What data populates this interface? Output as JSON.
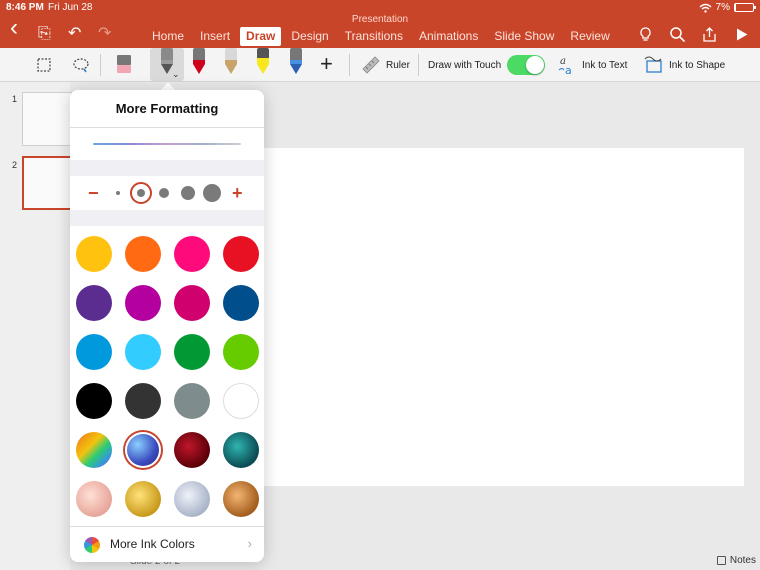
{
  "status": {
    "time": "8:46 PM",
    "day": "Fri Jun 28",
    "battery": "7%",
    "battery_level": 0.07,
    "wifi_icon": "wifi-icon",
    "battery_icon": "battery-icon"
  },
  "app": {
    "title": "Presentation",
    "accent": "#c8452a"
  },
  "appbar": {
    "back_icon": "‹",
    "file_icon": "⎘",
    "undo_icon": "↶",
    "redo_icon": "↷",
    "tabs": [
      {
        "label": "Home",
        "active": false
      },
      {
        "label": "Insert",
        "active": false
      },
      {
        "label": "Draw",
        "active": true
      },
      {
        "label": "Design",
        "active": false
      },
      {
        "label": "Transitions",
        "active": false
      },
      {
        "label": "Animations",
        "active": false
      },
      {
        "label": "Slide Show",
        "active": false
      },
      {
        "label": "Review",
        "active": false
      }
    ],
    "right_icons": {
      "lightbulb": "💡",
      "search": "⌕",
      "share": "⇪",
      "play": "▶"
    }
  },
  "ribbon": {
    "ruler_label": "Ruler",
    "draw_with_touch_label": "Draw with Touch",
    "draw_with_touch_on": true,
    "ink_to_text_label": "Ink to Text",
    "ink_to_shape_label": "Ink to Shape",
    "add_icon": "+",
    "pens": [
      {
        "name": "pen-gray",
        "band": "#9a9a9a"
      },
      {
        "name": "pen-red",
        "band": "#d0021b"
      },
      {
        "name": "pencil",
        "band": "#c8a46a"
      },
      {
        "name": "highlighter-yellow",
        "band": "#f8e71c"
      },
      {
        "name": "pen-galaxy",
        "band": "#4a90e2"
      }
    ]
  },
  "slides": {
    "items": [
      {
        "number": "1"
      },
      {
        "number": "2"
      }
    ],
    "footer": "Slide 2 of 2",
    "notes_label": "Notes"
  },
  "popover": {
    "title": "More Formatting",
    "minus": "−",
    "plus": "+",
    "more_ink_colors": "More Ink Colors",
    "chevron": "›",
    "colors": [
      {
        "name": "yellow",
        "fill": "#ffc20e"
      },
      {
        "name": "orange",
        "fill": "#ff6a13"
      },
      {
        "name": "pink",
        "fill": "#ff0a7a"
      },
      {
        "name": "red",
        "fill": "#e81123"
      },
      {
        "name": "purple",
        "fill": "#5c2d91"
      },
      {
        "name": "magenta",
        "fill": "#b4009e"
      },
      {
        "name": "crimson",
        "fill": "#d0006f"
      },
      {
        "name": "dark-blue",
        "fill": "#004e8c"
      },
      {
        "name": "blue",
        "fill": "#0099dd"
      },
      {
        "name": "sky-blue",
        "fill": "#33ccff"
      },
      {
        "name": "green",
        "fill": "#009933"
      },
      {
        "name": "lime",
        "fill": "#66cc00"
      },
      {
        "name": "black",
        "fill": "#000000"
      },
      {
        "name": "dark-gray",
        "fill": "#333333"
      },
      {
        "name": "gray",
        "fill": "#7f8c8d"
      },
      {
        "name": "white",
        "fill": "#ffffff"
      },
      {
        "name": "rainbow",
        "fill": "linear-gradient(135deg,#e74c3c,#f39c12,#f1c40f,#2ecc71,#3498db,#9b59b6)"
      },
      {
        "name": "galaxy",
        "fill": "radial-gradient(circle at 35% 35%,#8ad0ff,#3b4cc0 55%,#2b1d6e)",
        "selected": true
      },
      {
        "name": "ruby",
        "fill": "radial-gradient(circle at 40% 40%,#c0162a,#5a0008 70%)"
      },
      {
        "name": "ocean",
        "fill": "radial-gradient(circle at 40% 40%,#2fb4b0,#0b4a52 70%)"
      },
      {
        "name": "rose-gold",
        "fill": "radial-gradient(circle at 40% 40%,#ffe0d6,#e7a59a 70%)"
      },
      {
        "name": "gold",
        "fill": "radial-gradient(circle at 40% 40%,#ffe27a,#c89a1b 70%)"
      },
      {
        "name": "silver",
        "fill": "radial-gradient(circle at 40% 40%,#eef2fa,#aab4c8 70%)"
      },
      {
        "name": "bronze",
        "fill": "radial-gradient(circle at 40% 40%,#f3b574,#a35d1c 70%)"
      }
    ]
  }
}
